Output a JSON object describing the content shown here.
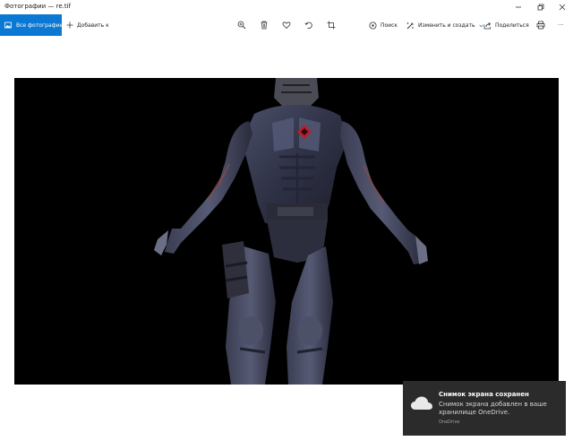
{
  "window": {
    "title": "Фотографии — re.tif"
  },
  "toolbar": {
    "all_photos_label": "Все фотографии",
    "add_to_label": "Добавить к",
    "search_label": "Поиск",
    "edit_create_label": "Изменить и создать",
    "share_label": "Поделиться",
    "more_label": "···",
    "accent_color": "#0b78d4"
  },
  "icons": {
    "all_photos": "photos-icon",
    "add_to": "plus-icon",
    "zoom": "zoom-icon",
    "delete": "trash-icon",
    "favorite": "heart-icon",
    "rotate": "rotate-icon",
    "crop": "crop-icon",
    "search": "search-icon",
    "edit": "edit-create-icon",
    "share": "share-icon",
    "print": "print-icon"
  },
  "viewer": {
    "background_color": "#000000",
    "image_description_name": "armored-character-render"
  },
  "toast": {
    "title": "Снимок экрана сохранен",
    "body": "Снимок экрана добавлен в ваше хранилище OneDrive.",
    "source": "OneDrive",
    "background_color": "#2b2b2b"
  }
}
